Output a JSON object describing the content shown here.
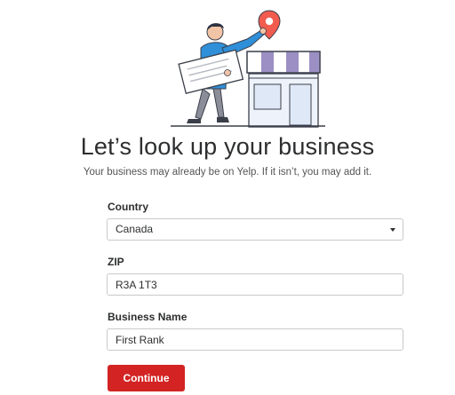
{
  "header": {
    "title": "Let’s look up your business",
    "subtitle": "Your business may already be on Yelp. If it isn’t, you may add it."
  },
  "form": {
    "country": {
      "label": "Country",
      "value": "Canada"
    },
    "zip": {
      "label": "ZIP",
      "value": "R3A 1T3"
    },
    "business_name": {
      "label": "Business Name",
      "value": "First Rank"
    },
    "continue_label": "Continue"
  },
  "colors": {
    "accent": "#d32323",
    "awning_stripe": "#9b8fc4",
    "shirt": "#2f8fd8",
    "pin": "#f15c4f"
  },
  "icons": {
    "illustration": "person-with-map-pin-storefront-illustration",
    "caret": "chevron-down-icon"
  }
}
